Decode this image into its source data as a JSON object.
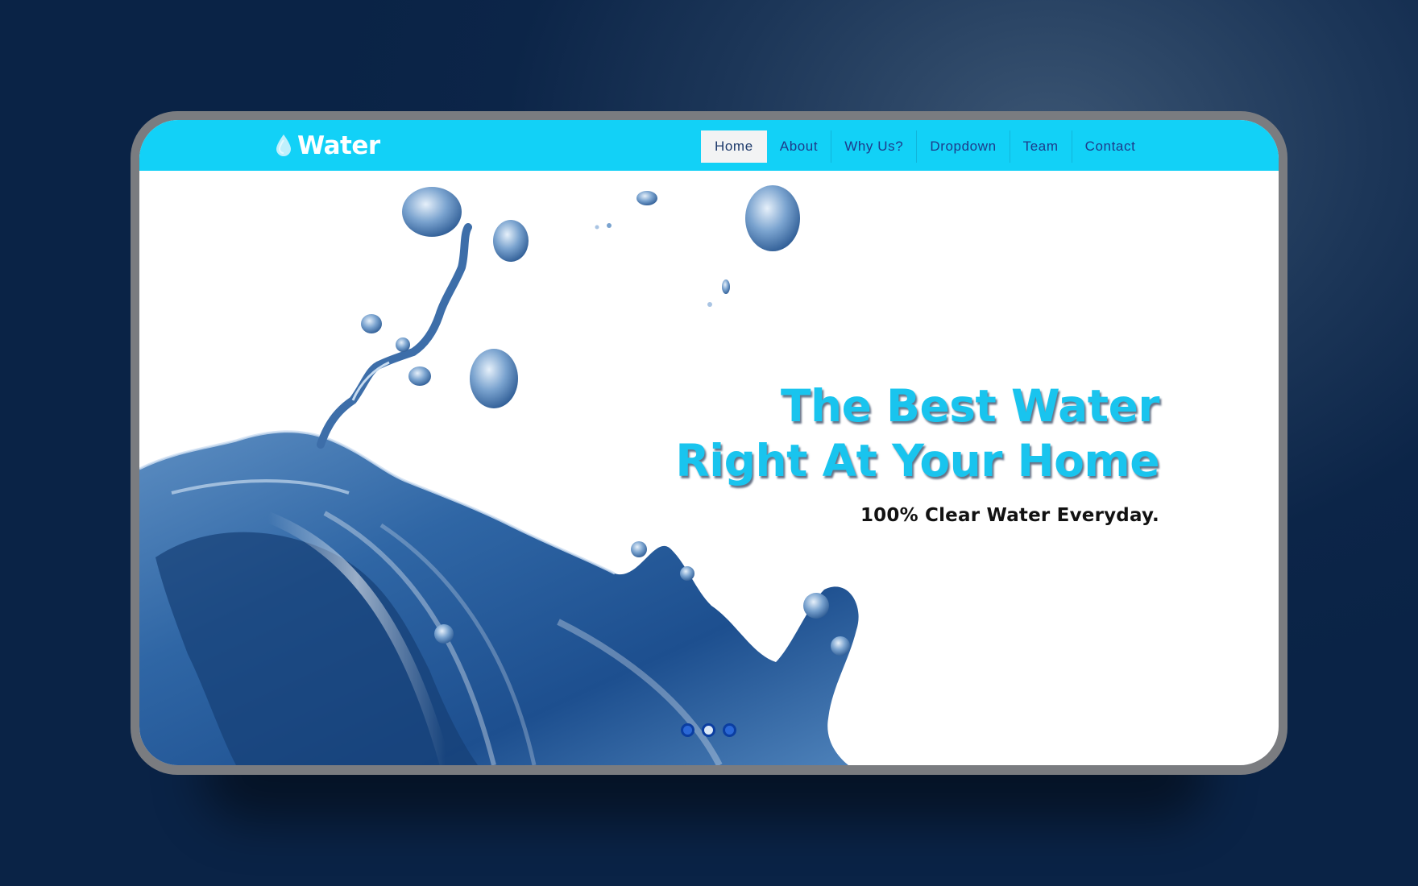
{
  "site": {
    "brand": "Water",
    "logo_icon": "water-drop-icon"
  },
  "nav": {
    "items": [
      {
        "label": "Home",
        "active": true
      },
      {
        "label": "About",
        "active": false
      },
      {
        "label": "Why Us?",
        "active": false
      },
      {
        "label": "Dropdown",
        "active": false
      },
      {
        "label": "Team",
        "active": false
      },
      {
        "label": "Contact",
        "active": false
      }
    ]
  },
  "hero": {
    "headline_line1": "The Best Water",
    "headline_line2": "Right At Your Home",
    "subheadline": "100% Clear Water Everyday.",
    "slides": 3,
    "active_slide": 2
  },
  "colors": {
    "navbar": "#12d1f7",
    "headline": "#19c4ee",
    "nav_text": "#1e3a8a",
    "background": "#0c2548"
  }
}
